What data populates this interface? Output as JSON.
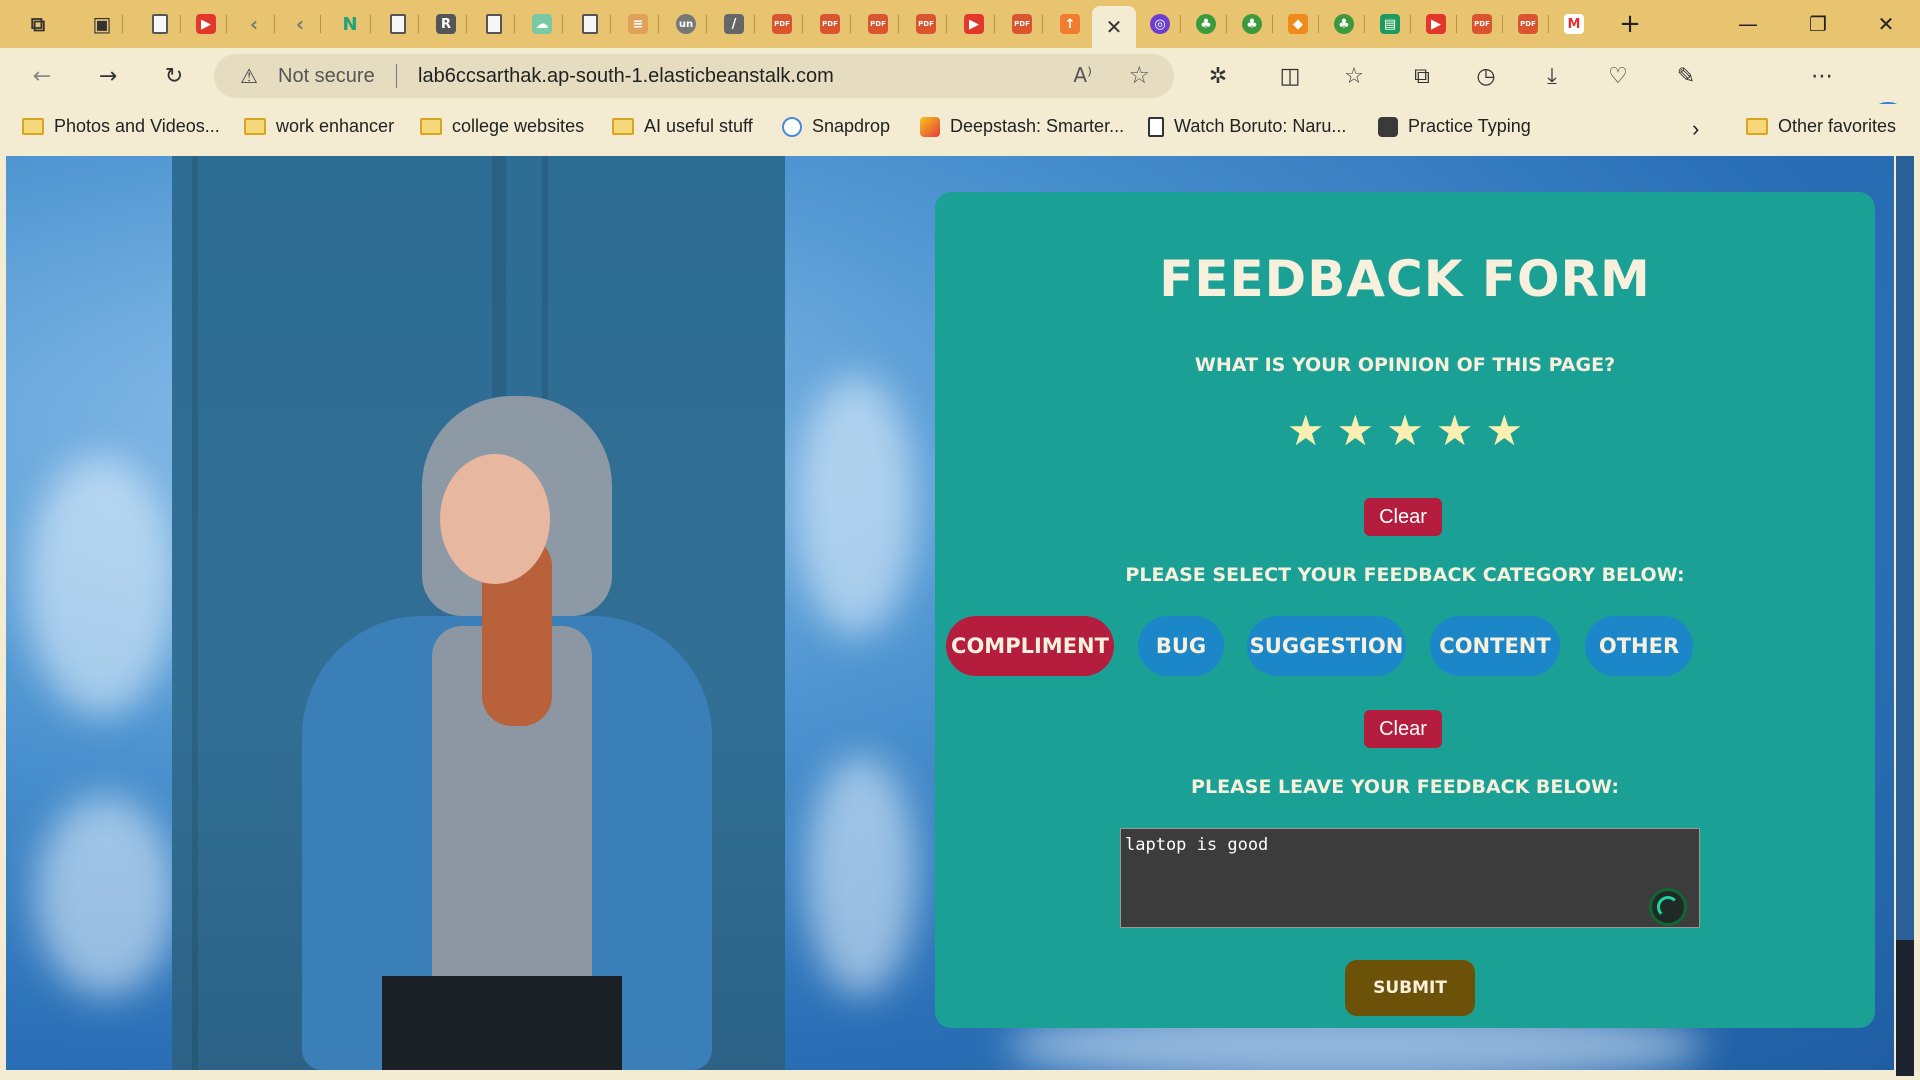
{
  "browser": {
    "tabs": [
      {
        "icon": "workspaces-icon"
      },
      {
        "icon": "tab-actions-icon"
      },
      {
        "icon": "document-icon"
      },
      {
        "icon": "youtube-icon"
      },
      {
        "icon": "back-arrow-icon"
      },
      {
        "icon": "back-arrow-icon"
      },
      {
        "icon": "notion-n-icon"
      },
      {
        "icon": "document-icon"
      },
      {
        "icon": "r-icon"
      },
      {
        "icon": "document-icon"
      },
      {
        "icon": "cloud-icon"
      },
      {
        "icon": "document-icon"
      },
      {
        "icon": "stack-icon"
      },
      {
        "icon": "un-icon"
      },
      {
        "icon": "slash-icon"
      },
      {
        "icon": "pdf-icon"
      },
      {
        "icon": "pdf-icon"
      },
      {
        "icon": "pdf-icon"
      },
      {
        "icon": "pdf-icon"
      },
      {
        "icon": "youtube-icon"
      },
      {
        "icon": "pdf-icon"
      },
      {
        "icon": "upload-icon"
      },
      {
        "icon": "close-icon",
        "active": true
      },
      {
        "icon": "purple-icon"
      },
      {
        "icon": "bulb-icon"
      },
      {
        "icon": "bulb-icon"
      },
      {
        "icon": "cube-icon"
      },
      {
        "icon": "bulb-icon"
      },
      {
        "icon": "green-book-icon"
      },
      {
        "icon": "youtube-icon"
      },
      {
        "icon": "pdf-icon"
      },
      {
        "icon": "pdf-icon"
      },
      {
        "icon": "gmail-icon"
      }
    ],
    "new_tab": "+",
    "address": {
      "security": "Not secure",
      "url": "lab6ccsarthak.ap-south-1.elasticbeanstalk.com"
    },
    "bookmarks": [
      {
        "label": "Photos and Videos...",
        "icon": "folder-icon"
      },
      {
        "label": "work enhancer",
        "icon": "folder-icon"
      },
      {
        "label": "college websites",
        "icon": "folder-icon"
      },
      {
        "label": "AI useful stuff",
        "icon": "folder-icon"
      },
      {
        "label": "Snapdrop",
        "icon": "snapdrop-icon"
      },
      {
        "label": "Deepstash: Smarter...",
        "icon": "deepstash-icon"
      },
      {
        "label": "Watch Boruto: Naru...",
        "icon": "document-icon"
      },
      {
        "label": "Practice Typing",
        "icon": "typing-icon"
      }
    ],
    "other_favorites": "Other favorites"
  },
  "form": {
    "title": "Feedback Form",
    "opinion_question": "What is your opinion of this page?",
    "stars": [
      "★",
      "★",
      "★",
      "★",
      "★"
    ],
    "clear_label": "Clear",
    "category_question": "Please select your feedback category below:",
    "categories": [
      {
        "label": "compliment",
        "selected": true
      },
      {
        "label": "bug",
        "selected": false
      },
      {
        "label": "suggestion",
        "selected": false
      },
      {
        "label": "content",
        "selected": false
      },
      {
        "label": "other",
        "selected": false
      }
    ],
    "feedback_question": "Please leave your feedback below:",
    "feedback_value": "laptop is good",
    "submit_label": "Submit"
  },
  "colors": {
    "card": "#1ba096",
    "selected_category": "#b41d3e",
    "category": "#1b87c8",
    "submit": "#6c5208",
    "star": "#f8efb0"
  }
}
